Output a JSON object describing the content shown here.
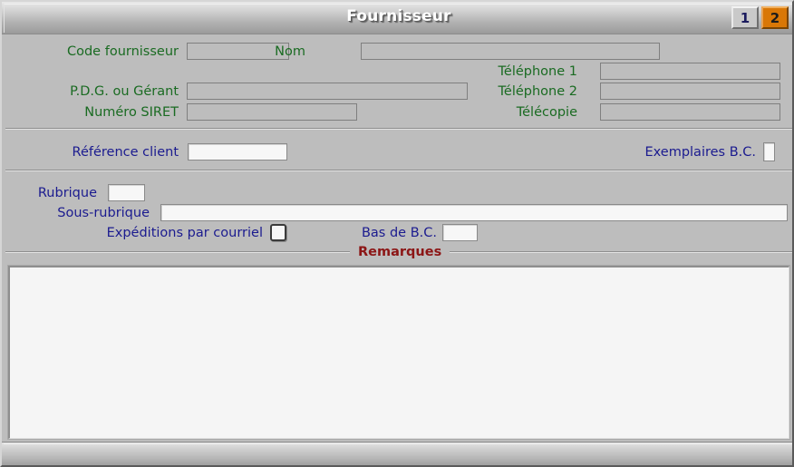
{
  "window": {
    "title": "Fournisseur",
    "colors": {
      "background": "#bdbdbd",
      "label_green": "#1a6b22",
      "label_navy": "#1b1b8f",
      "label_maroon": "#8c1616",
      "tab_active": "#d97706",
      "field_editable": "#f7f7f7"
    }
  },
  "tabs": [
    {
      "label": "1",
      "state": "inactive"
    },
    {
      "label": "2",
      "state": "active"
    }
  ],
  "identity_section": {
    "fields": [
      {
        "label": "Code fournisseur",
        "value": "",
        "placeholder": "",
        "editable": false
      },
      {
        "label": "Nom",
        "value": "",
        "placeholder": "",
        "editable": false
      },
      {
        "label": "Téléphone 1",
        "value": "",
        "placeholder": "",
        "editable": false
      },
      {
        "label": "P.D.G. ou Gérant",
        "value": "",
        "placeholder": "",
        "editable": false
      },
      {
        "label": "Téléphone 2",
        "value": "",
        "placeholder": "",
        "editable": false
      },
      {
        "label": "Numéro SIRET",
        "value": "",
        "placeholder": "",
        "editable": false
      },
      {
        "label": "Télécopie",
        "value": "",
        "placeholder": "",
        "editable": false
      }
    ]
  },
  "client_section": {
    "fields": [
      {
        "label": "Référence client",
        "value": "",
        "placeholder": "",
        "editable": true
      },
      {
        "label": "Exemplaires B.C.",
        "value": "",
        "placeholder": "",
        "editable": true
      }
    ]
  },
  "rubrique_section": {
    "fields": [
      {
        "label": "Rubrique",
        "value": "",
        "placeholder": "",
        "editable": true
      },
      {
        "label": "Sous-rubrique",
        "value": "",
        "placeholder": "",
        "editable": true
      },
      {
        "label": "Expéditions par courriel",
        "value": "",
        "checked": false,
        "editable": true
      },
      {
        "label": "Bas de B.C.",
        "value": "",
        "placeholder": "",
        "editable": true
      }
    ]
  },
  "remarks_section": {
    "legend": "Remarques",
    "value": "",
    "placeholder": ""
  },
  "statusbar": {
    "text": ""
  }
}
